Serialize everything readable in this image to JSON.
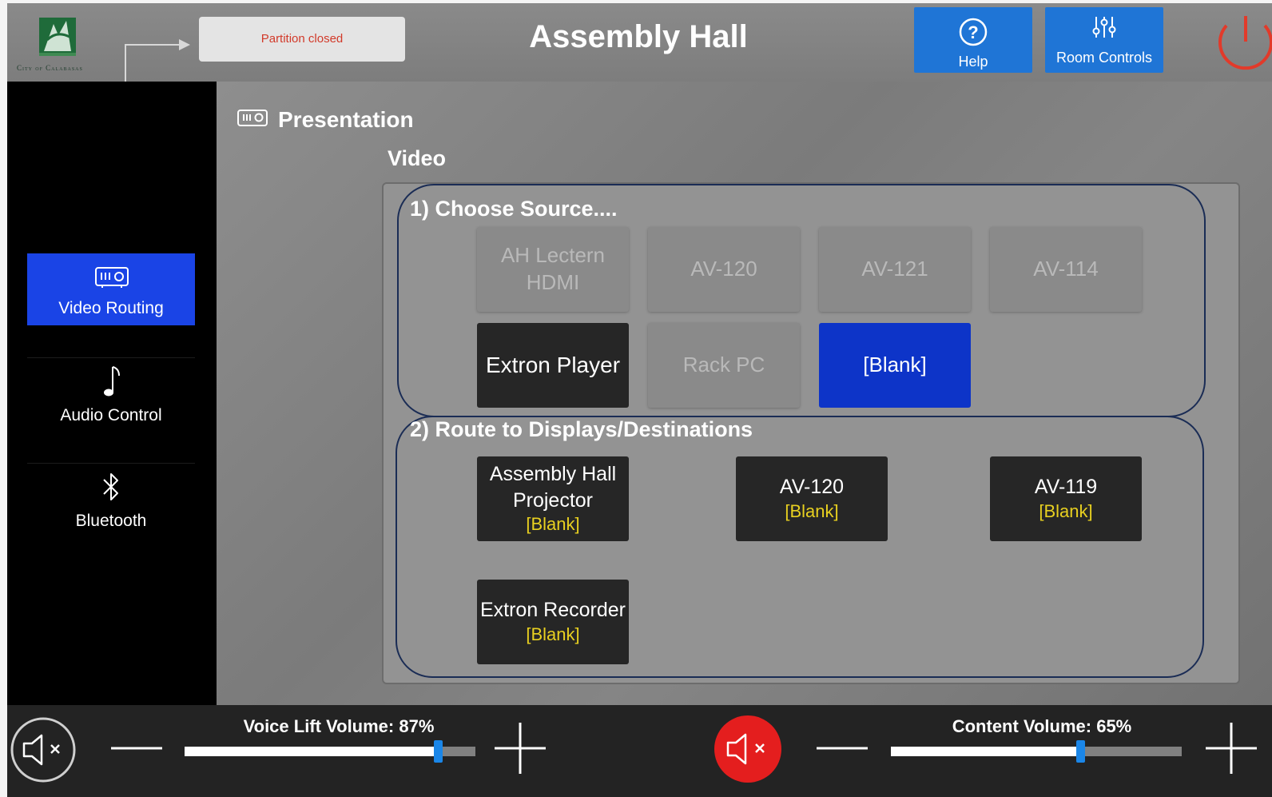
{
  "header": {
    "logo_text": "City of Calabasas",
    "partition_status": "Partition closed",
    "title": "Assembly Hall",
    "help_label": "Help",
    "room_controls_label": "Room Controls",
    "help_icon": "help-circle-icon",
    "room_controls_icon": "sliders-icon",
    "power_icon": "power-icon"
  },
  "sidebar": {
    "items": [
      {
        "label": "Video Routing",
        "icon": "projector-icon",
        "active": true
      },
      {
        "label": "Audio Control",
        "icon": "music-note-icon",
        "active": false
      },
      {
        "label": "Bluetooth",
        "icon": "bluetooth-icon",
        "active": false
      }
    ]
  },
  "main": {
    "section_title": "Presentation",
    "subsection_title": "Video",
    "choose_source": {
      "title": "1) Choose Source....",
      "sources": [
        {
          "label": "AH Lectern HDMI",
          "state": "disabled"
        },
        {
          "label": "AV-120",
          "state": "disabled"
        },
        {
          "label": "AV-121",
          "state": "disabled"
        },
        {
          "label": "AV-114",
          "state": "disabled"
        },
        {
          "label": "Extron Player",
          "state": "available"
        },
        {
          "label": "Rack PC",
          "state": "disabled"
        },
        {
          "label": "[Blank]",
          "state": "selected"
        }
      ]
    },
    "route": {
      "title": "2) Route to Displays/Destinations",
      "destinations": [
        {
          "label": "Assembly Hall Projector",
          "source": "[Blank]"
        },
        {
          "label": "AV-120",
          "source": "[Blank]"
        },
        {
          "label": "AV-119",
          "source": "[Blank]"
        },
        {
          "label": "Extron Recorder",
          "source": "[Blank]"
        }
      ]
    }
  },
  "bottom": {
    "voice_lift": {
      "label": "Voice Lift Volume: 87%",
      "level": 0.87,
      "muted": false
    },
    "content": {
      "label": "Content Volume: 65%",
      "level": 0.65,
      "muted": true
    },
    "mute_icon": "speaker-mute-icon",
    "minus_icon": "minus-icon",
    "plus_icon": "plus-icon"
  },
  "colors": {
    "accent_blue": "#1f75d6",
    "nav_active": "#1a44e6",
    "selected_source": "#0d34c8",
    "mute_red": "#e41e1e",
    "route_source_text": "#e8d020",
    "partition_text": "#d23a2a"
  }
}
